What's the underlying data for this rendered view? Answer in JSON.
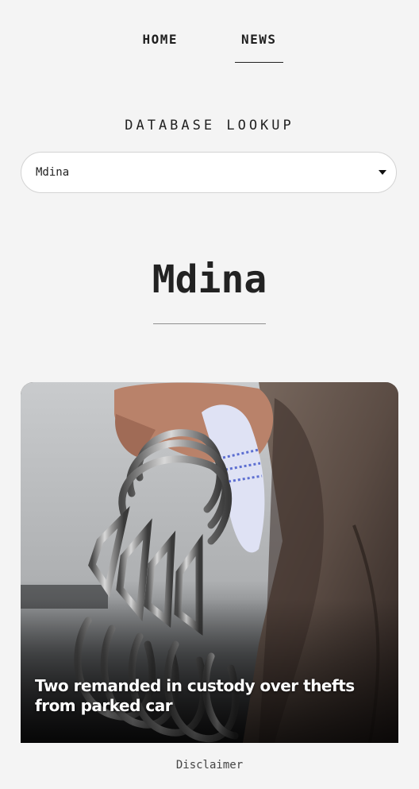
{
  "nav": {
    "items": [
      {
        "label": "HOME",
        "active": false
      },
      {
        "label": "NEWS",
        "active": true
      }
    ]
  },
  "lookup": {
    "title": "DATABASE LOOKUP",
    "selected": "Mdina"
  },
  "place": {
    "heading": "Mdina"
  },
  "articles": [
    {
      "title": "Two remanded in custody over thefts from parked car"
    }
  ],
  "footer": {
    "disclaimer_label": "Disclaimer"
  }
}
